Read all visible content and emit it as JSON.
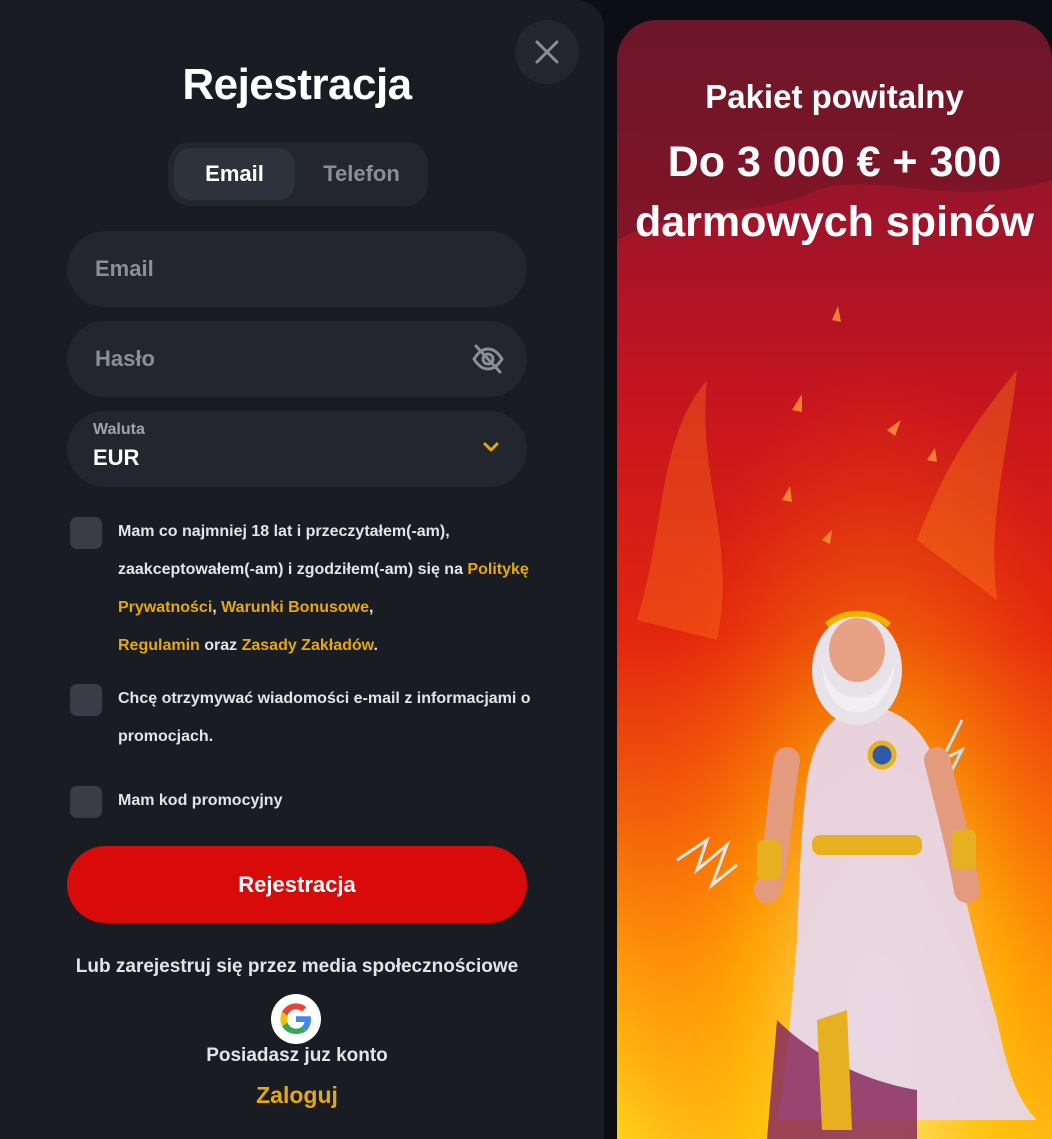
{
  "modal": {
    "title": "Rejestracja",
    "tabs": [
      {
        "label": "Email",
        "active": true
      },
      {
        "label": "Telefon",
        "active": false
      }
    ],
    "email_placeholder": "Email",
    "password_placeholder": "Hasło",
    "currency": {
      "label": "Waluta",
      "value": "EUR"
    },
    "terms": {
      "part1": "Mam co najmniej 18 lat i przeczytałem(-am), zaakceptowałem(-am) i zgodziłem(-am) się na ",
      "link_privacy": "Politykę Prywatności",
      "sep1": ", ",
      "link_bonus": "Warunki Bonusowe",
      "sep2": ", ",
      "link_rules": "Regulamin",
      "sep3": " oraz ",
      "link_betting": "Zasady Zakładów",
      "end": "."
    },
    "newsletter_label": "Chcę otrzymywać wiadomości e-mail z informacjami o promocjach.",
    "promo_code_label": "Mam kod promocyjny",
    "submit_label": "Rejestracja",
    "social_text": "Lub zarejestruj się przez media społecznościowe",
    "have_account": "Posiadasz juz konto",
    "login_label": "Zaloguj"
  },
  "promo": {
    "subtitle": "Pakiet powitalny",
    "headline": "Do 3 000 € + 300 darmowych spinów"
  },
  "colors": {
    "panel": "#1a1c24",
    "field": "#23262f",
    "accent_red": "#d80a0a",
    "link_gold": "#e6a90a"
  }
}
